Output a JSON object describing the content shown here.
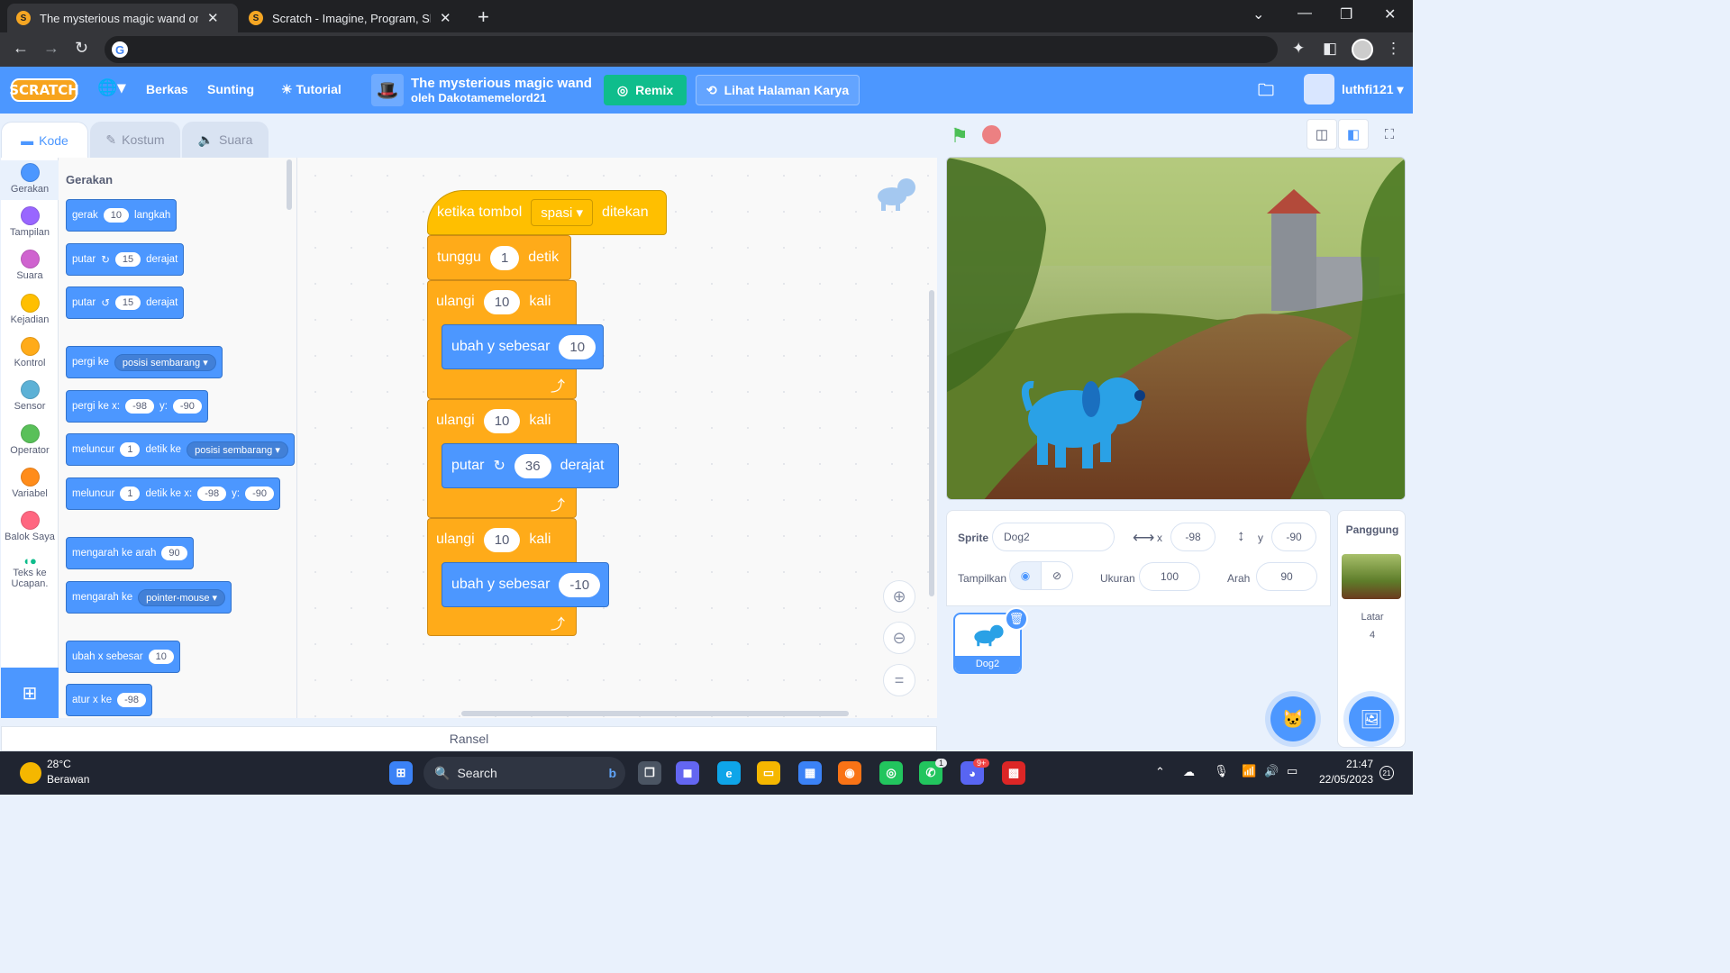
{
  "browser": {
    "tabs": [
      {
        "title": "The mysterious magic wand on S",
        "active": true
      },
      {
        "title": "Scratch - Imagine, Program, Shar",
        "active": false
      }
    ],
    "window_controls": [
      "minimize",
      "restore",
      "close"
    ]
  },
  "menubar": {
    "logo": "SCRATCH",
    "items": {
      "file": "Berkas",
      "edit": "Sunting",
      "tutorial": "Tutorial"
    },
    "project_title": "The mysterious magic wand",
    "project_author": "oleh Dakotamemelord21",
    "remix": "Remix",
    "see_project_page": "Lihat Halaman Karya",
    "username": "luthfi121"
  },
  "editor_tabs": {
    "code": "Kode",
    "costume": "Kostum",
    "sound": "Suara"
  },
  "categories": [
    {
      "label": "Gerakan",
      "color": "#4c97ff"
    },
    {
      "label": "Tampilan",
      "color": "#9966ff"
    },
    {
      "label": "Suara",
      "color": "#cf63cf"
    },
    {
      "label": "Kejadian",
      "color": "#ffbf00"
    },
    {
      "label": "Kontrol",
      "color": "#ffab19"
    },
    {
      "label": "Sensor",
      "color": "#5cb1d6"
    },
    {
      "label": "Operator",
      "color": "#59c059"
    },
    {
      "label": "Variabel",
      "color": "#ff8c1a"
    },
    {
      "label": "Balok Saya",
      "color": "#ff6680"
    },
    {
      "label": "Teks ke Ucapan.",
      "color": "#0fbd8c"
    }
  ],
  "palette": {
    "title": "Gerakan",
    "move": {
      "a": "gerak",
      "v": "10",
      "b": "langkah"
    },
    "turn_right": {
      "a": "putar",
      "v": "15",
      "b": "derajat"
    },
    "turn_left": {
      "a": "putar",
      "v": "15",
      "b": "derajat"
    },
    "goto": {
      "a": "pergi ke",
      "dd": "posisi sembarang"
    },
    "goto_xy": {
      "a": "pergi ke x:",
      "x": "-98",
      "yl": "y:",
      "y": "-90"
    },
    "glide": {
      "a": "meluncur",
      "v": "1",
      "b": "detik ke",
      "dd": "posisi sembarang"
    },
    "glide_xy": {
      "a": "meluncur",
      "v": "1",
      "b": "detik ke x:",
      "x": "-98",
      "yl": "y:",
      "y": "-90"
    },
    "point_dir": {
      "a": "mengarah ke arah",
      "v": "90"
    },
    "point_towards": {
      "a": "mengarah ke",
      "dd": "pointer-mouse"
    },
    "change_x": {
      "a": "ubah x sebesar",
      "v": "10"
    },
    "set_x": {
      "a": "atur x ke",
      "v": "-98"
    }
  },
  "script": {
    "hat": {
      "a": "ketika tombol",
      "dd": "spasi",
      "b": "ditekan"
    },
    "wait": {
      "a": "tunggu",
      "v": "1",
      "b": "detik"
    },
    "repeat1": {
      "a": "ulangi",
      "v": "10",
      "b": "kali"
    },
    "change_y1": {
      "a": "ubah y sebesar",
      "v": "10"
    },
    "repeat2": {
      "a": "ulangi",
      "v": "10",
      "b": "kali"
    },
    "turn": {
      "a": "putar",
      "v": "36",
      "b": "derajat"
    },
    "repeat3": {
      "a": "ulangi",
      "v": "10",
      "b": "kali"
    },
    "change_y2": {
      "a": "ubah y sebesar",
      "v": "-10"
    }
  },
  "backpack": "Ransel",
  "sprite_info": {
    "sprite_label": "Sprite",
    "sprite_name": "Dog2",
    "x_label": "x",
    "x": "-98",
    "y_label": "y",
    "y": "-90",
    "show_label": "Tampilkan",
    "size_label": "Ukuran",
    "size": "100",
    "direction_label": "Arah",
    "direction": "90"
  },
  "sprites": [
    {
      "name": "Dog2"
    }
  ],
  "stage_panel": {
    "title": "Panggung",
    "backdrops_label": "Latar",
    "backdrops_count": "4"
  },
  "taskbar": {
    "weather_temp": "28°C",
    "weather_desc": "Berawan",
    "search": "Search",
    "time": "21:47",
    "date": "22/05/2023",
    "notif_count": "21",
    "whatsapp_badge": "1",
    "discord_badge": "9+"
  }
}
